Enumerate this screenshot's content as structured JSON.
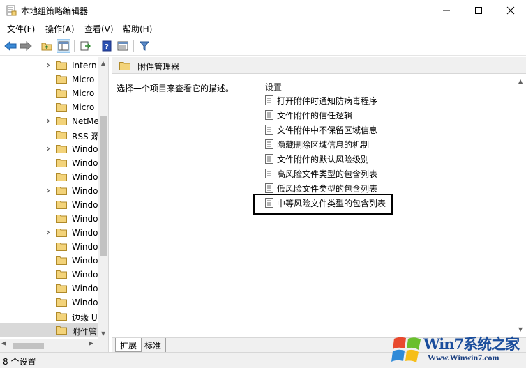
{
  "window": {
    "title": "本地组策略编辑器",
    "minimize": "—",
    "maximize": "☐",
    "close": "✕"
  },
  "menu": {
    "file": "文件(F)",
    "action": "操作(A)",
    "view": "查看(V)",
    "help": "帮助(H)"
  },
  "toolbar": {
    "icons": [
      "back-arrow-icon",
      "forward-arrow-icon",
      "up-folder-icon",
      "show-hide-tree-icon",
      "export-list-icon",
      "help-icon",
      "properties-icon",
      "filter-icon"
    ]
  },
  "tree": {
    "items": [
      {
        "label": "Intern",
        "expandable": true
      },
      {
        "label": "Micro",
        "expandable": false
      },
      {
        "label": "Micro",
        "expandable": false
      },
      {
        "label": "Micro",
        "expandable": false
      },
      {
        "label": "NetMe",
        "expandable": true
      },
      {
        "label": "RSS 源",
        "expandable": false
      },
      {
        "label": "Windo",
        "expandable": true
      },
      {
        "label": "Windo",
        "expandable": false
      },
      {
        "label": "Windo",
        "expandable": false
      },
      {
        "label": "Windo",
        "expandable": true
      },
      {
        "label": "Windo",
        "expandable": false
      },
      {
        "label": "Windo",
        "expandable": false
      },
      {
        "label": "Windo",
        "expandable": true
      },
      {
        "label": "Windo",
        "expandable": false
      },
      {
        "label": "Windo",
        "expandable": false
      },
      {
        "label": "Windo",
        "expandable": false
      },
      {
        "label": "Windo",
        "expandable": false
      },
      {
        "label": "Windo",
        "expandable": false
      },
      {
        "label": "边缘 U",
        "expandable": false
      },
      {
        "label": "附件管",
        "expandable": false,
        "selected": true
      }
    ]
  },
  "right": {
    "header": "附件管理器",
    "description": "选择一个项目来查看它的描述。",
    "settings_header": "设置",
    "settings": [
      "打开附件时通知防病毒程序",
      "文件附件的信任逻辑",
      "文件附件中不保留区域信息",
      "隐藏删除区域信息的机制",
      "文件附件的默认风险级别",
      "高风险文件类型的包含列表",
      "低风险文件类型的包含列表",
      "中等风险文件类型的包含列表"
    ],
    "tabs": [
      "扩展",
      "标准"
    ]
  },
  "status": {
    "text": "8 个设置"
  },
  "watermark": {
    "brand": "Win7系统之家",
    "url": "Www.Winwin7.com"
  },
  "colors": {
    "accent": "#0078d7",
    "folder": "#f3d37a",
    "watermark": "#1a4d9c"
  }
}
